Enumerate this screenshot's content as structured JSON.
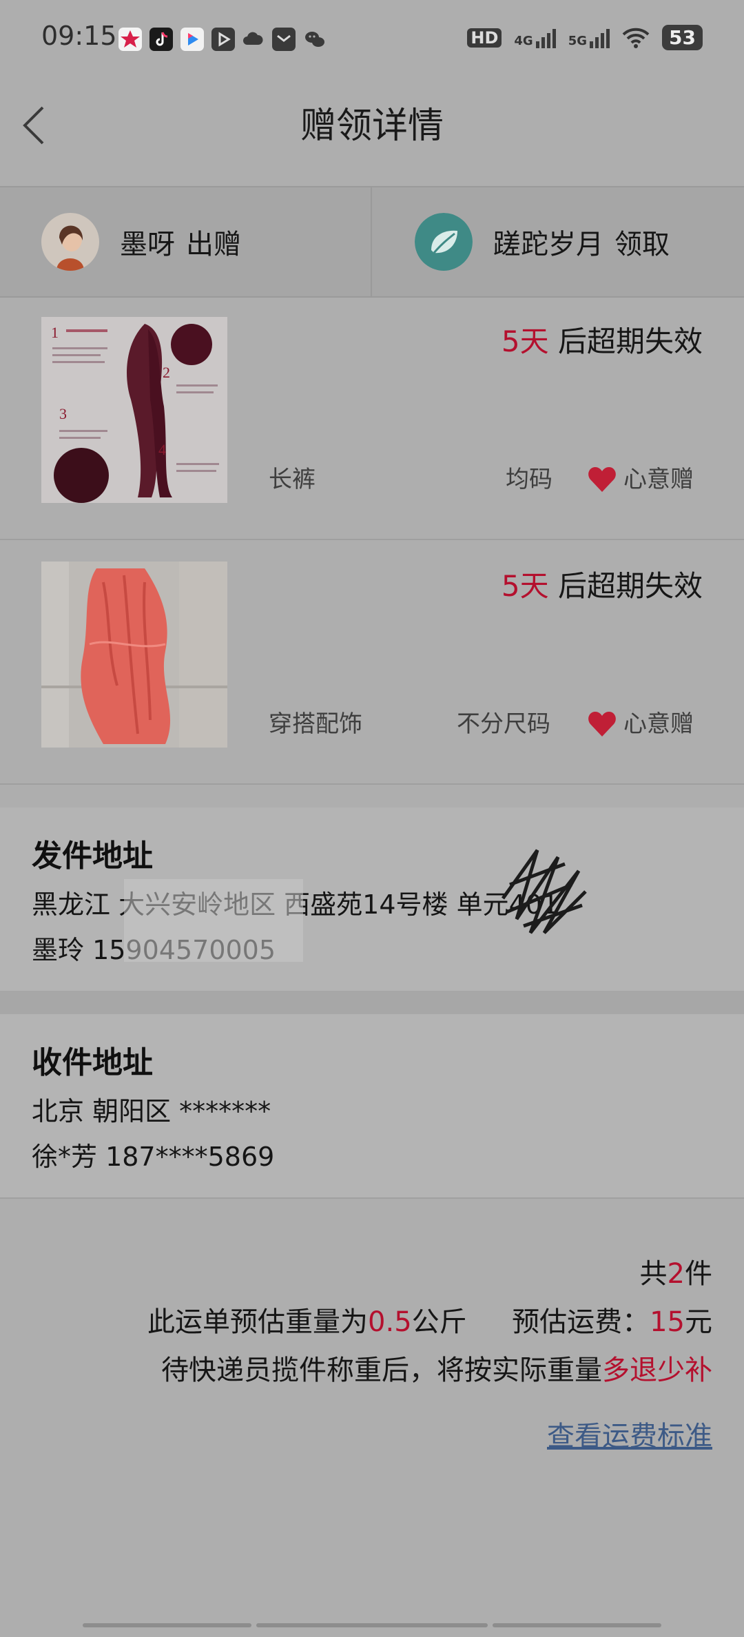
{
  "status_bar": {
    "time": "09:15",
    "battery": "53",
    "hd": "HD",
    "net_4g": "4G",
    "net_5g": "5G"
  },
  "header": {
    "title": "赠领详情"
  },
  "parties": {
    "giver": {
      "name": "墨呀",
      "action": "出赠"
    },
    "receiver": {
      "name": "蹉跎岁月",
      "action": "领取"
    }
  },
  "items": [
    {
      "expire_days": "5天",
      "expire_text": "后超期失效",
      "category": "长裤",
      "size": "均码",
      "tag": "心意赠"
    },
    {
      "expire_days": "5天",
      "expire_text": "后超期失效",
      "category": "穿搭配饰",
      "size": "不分尺码",
      "tag": "心意赠"
    }
  ],
  "sender": {
    "title": "发件地址",
    "address": "黑龙江 大兴安岭地区 西盛苑14号楼 单元401",
    "contact": "墨玲 15904570005"
  },
  "receiver": {
    "title": "收件地址",
    "address": "北京 朝阳区 *******",
    "contact": "徐*芳 187****5869"
  },
  "summary": {
    "count_prefix": "共",
    "count": "2",
    "count_suffix": "件",
    "weight_prefix": "此运单预估重量为",
    "weight": "0.5",
    "weight_unit": "公斤",
    "fee_label": "预估运费：",
    "fee": "15",
    "fee_unit": "元",
    "note_prefix": "待快递员揽件称重后，将按实际重量",
    "note_highlight": "多退少补",
    "link_text": "查看运费标准"
  },
  "colors": {
    "accent_red": "#b4102e",
    "link_blue": "#3d5a86"
  }
}
